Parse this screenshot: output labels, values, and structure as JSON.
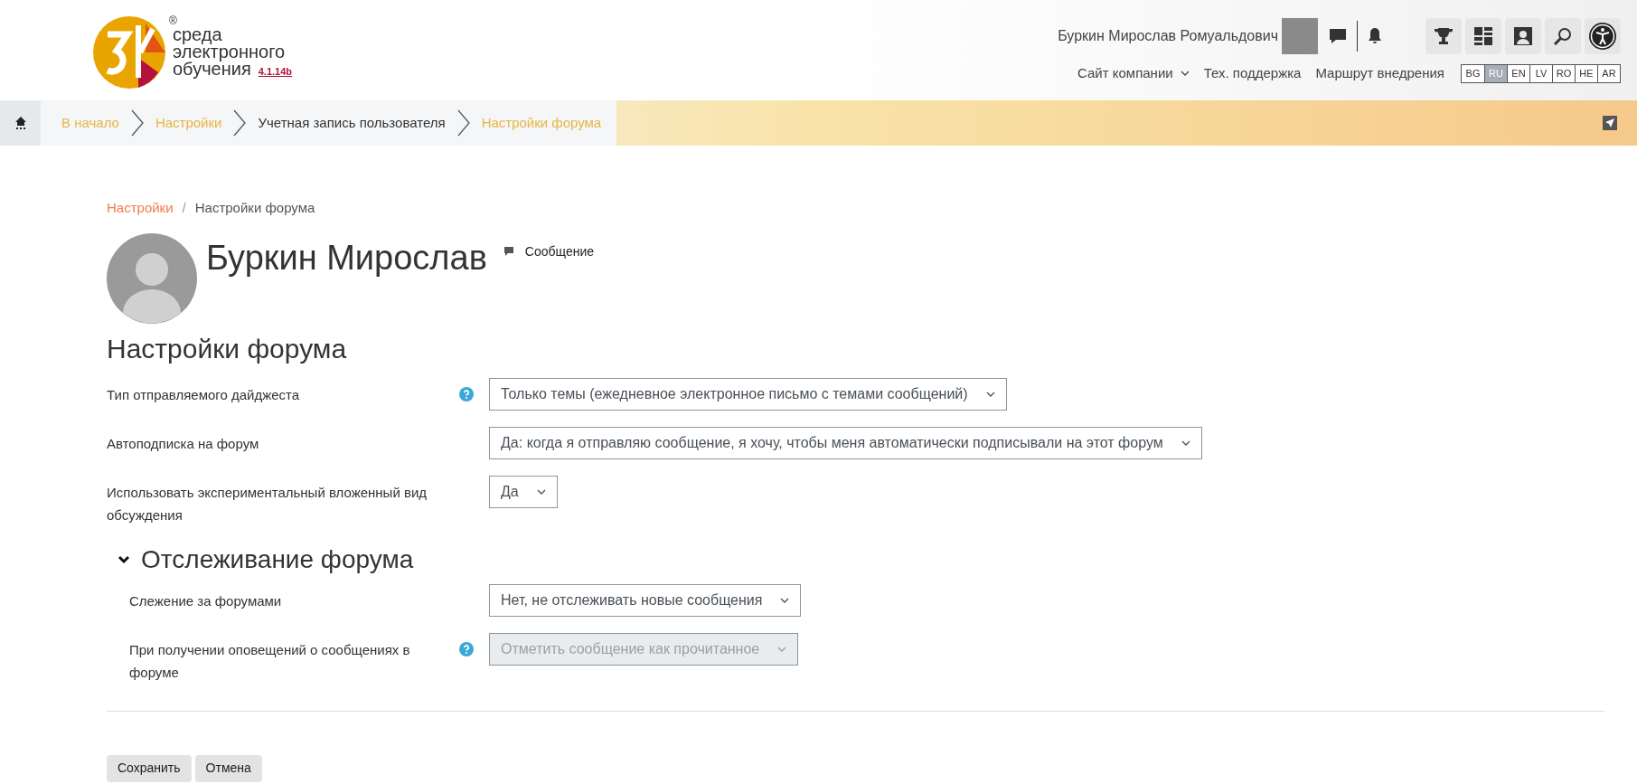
{
  "header": {
    "logo": {
      "registered": "®",
      "lines": [
        "среда",
        "электронного",
        "обучения"
      ],
      "version": "4.1.14b"
    },
    "user": {
      "name": "Буркин Мирослав Ромуальдович"
    },
    "nav_links": [
      {
        "label": "Сайт компании",
        "dropdown": true
      },
      {
        "label": "Тех. поддержка",
        "dropdown": false
      },
      {
        "label": "Маршрут внедрения",
        "dropdown": false
      }
    ],
    "languages": [
      {
        "label": "BG",
        "selected": false
      },
      {
        "label": "RU",
        "selected": true
      },
      {
        "label": "EN",
        "selected": false
      },
      {
        "label": "LV",
        "selected": false
      },
      {
        "label": "RO",
        "selected": false
      },
      {
        "label": "HE",
        "selected": false
      },
      {
        "label": "AR",
        "selected": false
      }
    ]
  },
  "breadcrumb_bar": [
    {
      "label": "В начало",
      "kind": "link"
    },
    {
      "label": "Настройки",
      "kind": "link"
    },
    {
      "label": "Учетная запись пользователя",
      "kind": "text"
    },
    {
      "label": "Настройки форума",
      "kind": "link"
    }
  ],
  "page_breadcrumb": [
    {
      "label": "Настройки",
      "kind": "link"
    },
    {
      "label": "Настройки форума",
      "kind": "text"
    }
  ],
  "page_breadcrumb_separator": "/",
  "profile": {
    "name": "Буркин Мирослав",
    "message_link": "Сообщение"
  },
  "heading": "Настройки форума",
  "fields": [
    {
      "label": "Тип отправляемого дайджеста",
      "help": true,
      "value": "Только темы (ежедневное электронное письмо с темами сообщений)",
      "disabled": false
    },
    {
      "label": "Автоподписка на форум",
      "help": false,
      "value": "Да: когда я отправляю сообщение, я хочу, чтобы меня автоматически подписывали на этот форум",
      "disabled": false
    },
    {
      "label": "Использовать экспериментальный вложенный вид обсуждения",
      "help": false,
      "value": "Да",
      "disabled": false
    }
  ],
  "section": {
    "title": "Отслеживание форума",
    "expanded": true,
    "fields": [
      {
        "label": "Слежение за форумами",
        "help": false,
        "value": "Нет, не отслеживать новые сообщения",
        "disabled": false
      },
      {
        "label": "При получении оповещений о сообщениях в форуме",
        "help": true,
        "value": "Отметить сообщение как прочитанное",
        "disabled": true
      }
    ]
  },
  "buttons": [
    "Сохранить",
    "Отмена"
  ]
}
